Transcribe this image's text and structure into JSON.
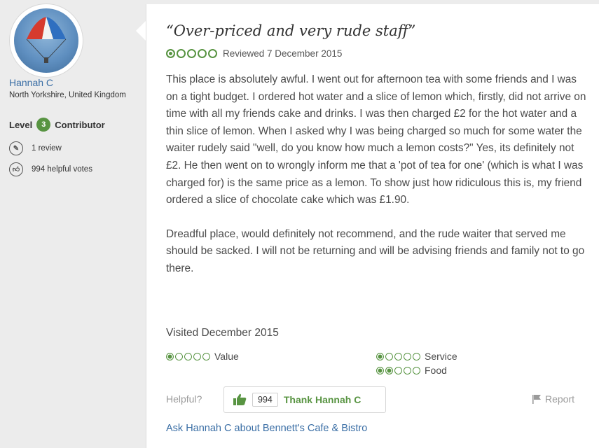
{
  "reviewer": {
    "name": "Hannah C",
    "location": "North Yorkshire, United Kingdom",
    "level_label": "Level",
    "level_number": "3",
    "level_title": "Contributor",
    "reviews_count": "1 review",
    "helpful_votes": "994 helpful votes"
  },
  "review": {
    "title": "“Over-priced and very rude staff”",
    "rating": 1,
    "reviewed_date": "Reviewed 7 December 2015",
    "paragraph1": "This place is absolutely awful. I went out for afternoon tea with some friends and I was on a tight budget. I ordered hot water and a slice of lemon which, firstly, did not arrive on time with all my friends cake and drinks. I was then charged £2 for the hot water and a thin slice of lemon. When I asked why I was being charged so much for some water the waiter rudely said \"well, do you know how much a lemon costs?\" Yes, its definitely not £2. He then went on to wrongly inform me that a 'pot of tea for one' (which is what I was charged for) is the same price as a lemon. To show just how ridiculous this is, my friend ordered a slice of chocolate cake which was £1.90.",
    "paragraph2": "Dreadful place, would definitely not recommend, and the rude waiter that served me should be sacked. I will not be returning and will be advising friends and family not to go there.",
    "visited": "Visited December 2015",
    "sub_ratings": [
      {
        "label": "Value",
        "rating": 1
      },
      {
        "label": "Service",
        "rating": 1
      },
      {
        "label": "Food",
        "rating": 2
      }
    ]
  },
  "actions": {
    "helpful_label": "Helpful?",
    "helpful_count": "994",
    "thank_label": "Thank Hannah C",
    "report_label": "Report",
    "ask_link": "Ask Hannah C about Bennett's Cafe & Bistro"
  },
  "colors": {
    "accent_green": "#589442",
    "link_blue": "#3a6ea5"
  }
}
